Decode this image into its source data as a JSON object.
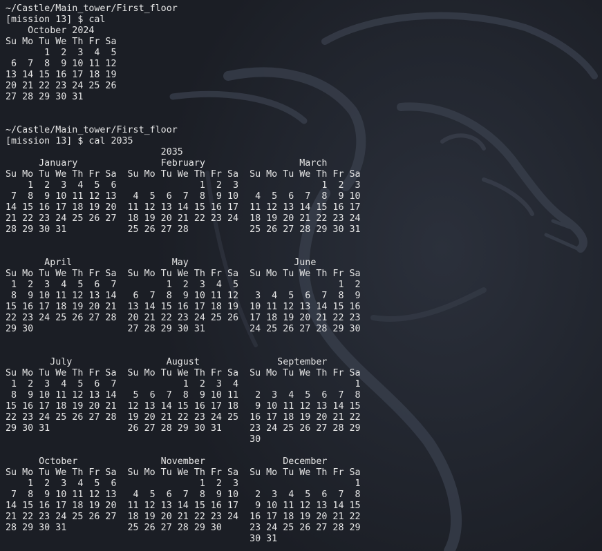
{
  "terminal": {
    "colors": {
      "background": "#1b1e25",
      "text": "#e6e6e6"
    },
    "blocks": [
      {
        "path": "~/Castle/Main_tower/First_floor",
        "prompt": "[mission 13] $ ",
        "command": "cal",
        "output": [
          "    October 2024",
          "Su Mo Tu We Th Fr Sa",
          "       1  2  3  4  5",
          " 6  7  8  9 10 11 12",
          "13 14 15 16 17 18 19",
          "20 21 22 23 24 25 26",
          "27 28 29 30 31",
          "",
          ""
        ]
      },
      {
        "path": "~/Castle/Main_tower/First_floor",
        "prompt": "[mission 13] $ ",
        "command": "cal 2035",
        "output": [
          "                            2035",
          "      January               February                 March",
          "Su Mo Tu We Th Fr Sa  Su Mo Tu We Th Fr Sa  Su Mo Tu We Th Fr Sa",
          "    1  2  3  4  5  6               1  2  3               1  2  3",
          " 7  8  9 10 11 12 13   4  5  6  7  8  9 10   4  5  6  7  8  9 10",
          "14 15 16 17 18 19 20  11 12 13 14 15 16 17  11 12 13 14 15 16 17",
          "21 22 23 24 25 26 27  18 19 20 21 22 23 24  18 19 20 21 22 23 24",
          "28 29 30 31           25 26 27 28           25 26 27 28 29 30 31",
          "",
          "",
          "       April                  May                   June",
          "Su Mo Tu We Th Fr Sa  Su Mo Tu We Th Fr Sa  Su Mo Tu We Th Fr Sa",
          " 1  2  3  4  5  6  7         1  2  3  4  5                  1  2",
          " 8  9 10 11 12 13 14   6  7  8  9 10 11 12   3  4  5  6  7  8  9",
          "15 16 17 18 19 20 21  13 14 15 16 17 18 19  10 11 12 13 14 15 16",
          "22 23 24 25 26 27 28  20 21 22 23 24 25 26  17 18 19 20 21 22 23",
          "29 30                 27 28 29 30 31        24 25 26 27 28 29 30",
          "",
          "",
          "        July                 August              September",
          "Su Mo Tu We Th Fr Sa  Su Mo Tu We Th Fr Sa  Su Mo Tu We Th Fr Sa",
          " 1  2  3  4  5  6  7            1  2  3  4                     1",
          " 8  9 10 11 12 13 14   5  6  7  8  9 10 11   2  3  4  5  6  7  8",
          "15 16 17 18 19 20 21  12 13 14 15 16 17 18   9 10 11 12 13 14 15",
          "22 23 24 25 26 27 28  19 20 21 22 23 24 25  16 17 18 19 20 21 22",
          "29 30 31              26 27 28 29 30 31     23 24 25 26 27 28 29",
          "                                            30",
          "",
          "      October               November              December",
          "Su Mo Tu We Th Fr Sa  Su Mo Tu We Th Fr Sa  Su Mo Tu We Th Fr Sa",
          "    1  2  3  4  5  6               1  2  3                     1",
          " 7  8  9 10 11 12 13   4  5  6  7  8  9 10   2  3  4  5  6  7  8",
          "14 15 16 17 18 19 20  11 12 13 14 15 16 17   9 10 11 12 13 14 15",
          "21 22 23 24 25 26 27  18 19 20 21 22 23 24  16 17 18 19 20 21 22",
          "28 29 30 31           25 26 27 28 29 30     23 24 25 26 27 28 29",
          "                                            30 31"
        ]
      }
    ]
  }
}
